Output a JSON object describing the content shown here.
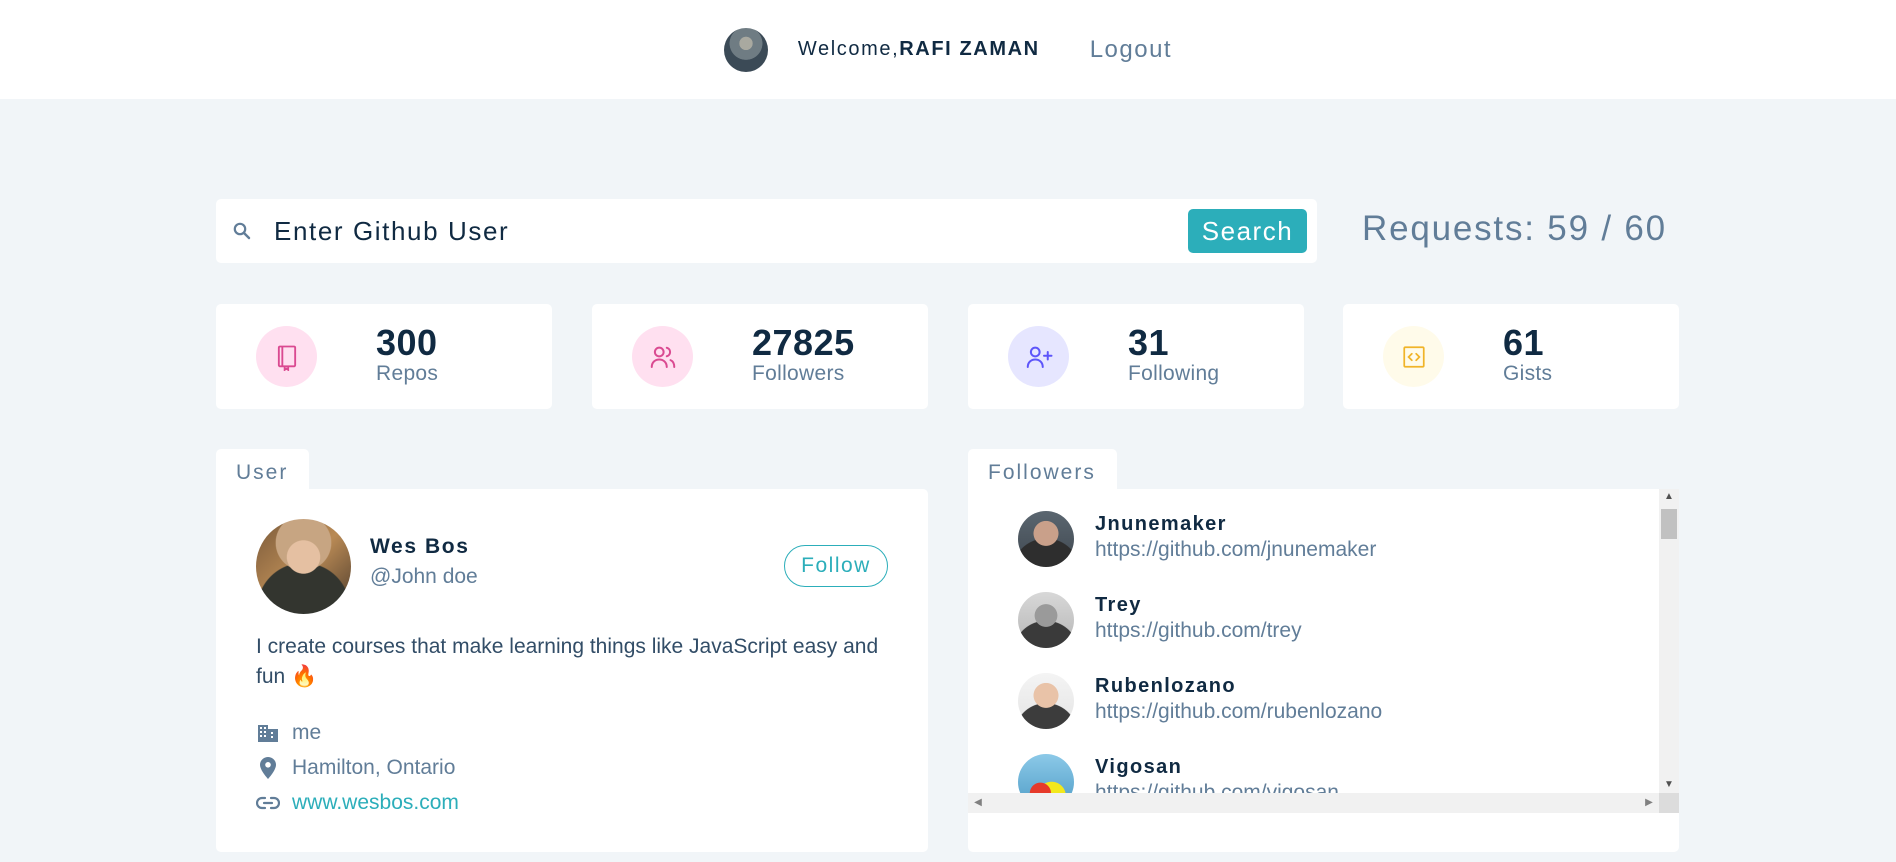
{
  "header": {
    "welcome_prefix": "Welcome,",
    "user_name": "RAFI ZAMAN",
    "logout_label": "Logout"
  },
  "search": {
    "placeholder": "Enter Github User",
    "button_label": "Search",
    "requests_text": "Requests: 59 / 60"
  },
  "stats": [
    {
      "value": "300",
      "label": "Repos",
      "icon": "book-icon",
      "icon_bg": "#ffe0f0",
      "icon_color": "#da4a91"
    },
    {
      "value": "27825",
      "label": "Followers",
      "icon": "users-icon",
      "icon_bg": "#ffe0f0",
      "icon_color": "#da4a91"
    },
    {
      "value": "31",
      "label": "Following",
      "icon": "user-plus-icon",
      "icon_bg": "#e6e6ff",
      "icon_color": "#5d55fa"
    },
    {
      "value": "61",
      "label": "Gists",
      "icon": "code-icon",
      "icon_bg": "#fffbea",
      "icon_color": "#f0b429"
    }
  ],
  "user_panel": {
    "tab_label": "User",
    "name": "Wes Bos",
    "handle": "@John doe",
    "follow_label": "Follow",
    "bio": "I create courses that make learning things like JavaScript easy and fun 🔥",
    "company": "me",
    "location": "Hamilton, Ontario",
    "blog": "www.wesbos.com"
  },
  "followers_panel": {
    "tab_label": "Followers",
    "items": [
      {
        "name": "Jnunemaker",
        "url": "https://github.com/jnunemaker"
      },
      {
        "name": "Trey",
        "url": "https://github.com/trey"
      },
      {
        "name": "Rubenlozano",
        "url": "https://github.com/rubenlozano"
      },
      {
        "name": "Vigosan",
        "url": "https://github.com/vigosan"
      }
    ]
  },
  "colors": {
    "primary": "#2caeba",
    "background": "#f1f5f8",
    "text_dark": "#102a42",
    "text_muted": "#617d98"
  }
}
